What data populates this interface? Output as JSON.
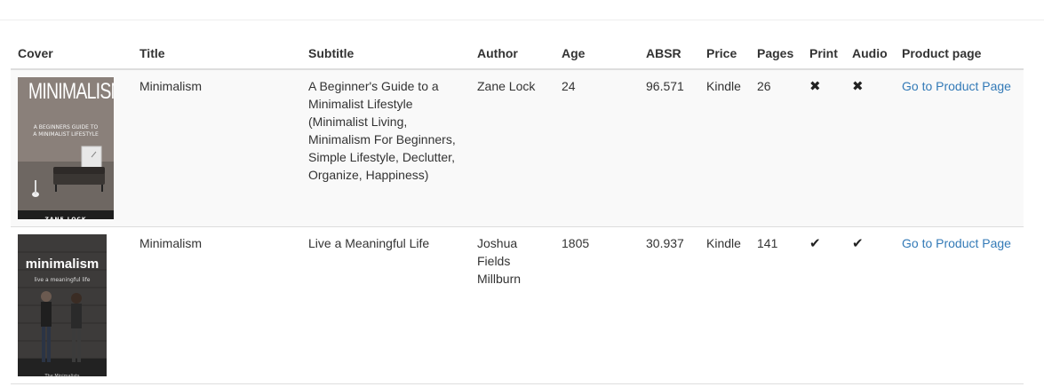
{
  "table": {
    "headers": {
      "cover": "Cover",
      "title": "Title",
      "subtitle": "Subtitle",
      "author": "Author",
      "age": "Age",
      "absr": "ABSR",
      "price": "Price",
      "pages": "Pages",
      "print": "Print",
      "audio": "Audio",
      "product_page": "Product page"
    },
    "rows": [
      {
        "cover": {
          "title": "MINIMALISM",
          "tagline_1": "A BEGINNERS GUIDE TO",
          "tagline_2": "A MINIMALIST LIFESTYLE",
          "author": "ZANE LOCK"
        },
        "title": "Minimalism",
        "subtitle": "A Beginner's Guide to a Minimalist Lifestyle (Minimalist Living, Minimalism For Beginners, Simple Lifestyle, Declutter, Organize, Happiness)",
        "author": "Zane Lock",
        "age": "24",
        "absr": "96.571",
        "price": "Kindle",
        "pages": "26",
        "print": "✖",
        "audio": "✖",
        "print_icon": "x-mark-icon",
        "audio_icon": "x-mark-icon",
        "link": "Go to Product Page"
      },
      {
        "cover": {
          "title": "minimalism",
          "tagline_1": "live a meaningful life",
          "author": "The Minimalists"
        },
        "title": "Minimalism",
        "subtitle": "Live a Meaningful Life",
        "author": "Joshua Fields Millburn",
        "age": "1805",
        "absr": "30.937",
        "price": "Kindle",
        "pages": "141",
        "print": "✔",
        "audio": "✔",
        "print_icon": "check-mark-icon",
        "audio_icon": "check-mark-icon",
        "link": "Go to Product Page"
      }
    ]
  },
  "colors": {
    "link": "#337ab7",
    "stripe": "#f9f9f9",
    "border": "#dddddd"
  }
}
